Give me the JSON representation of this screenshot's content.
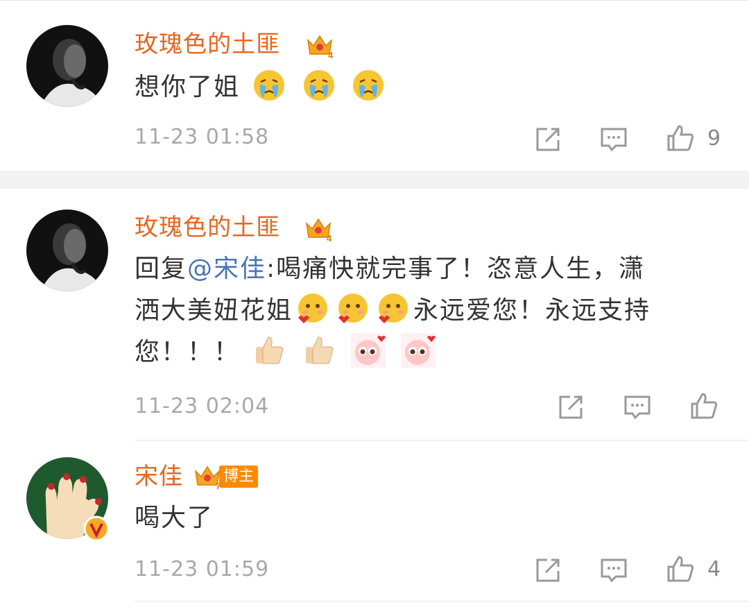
{
  "comments": [
    {
      "username": "玫瑰色的土匪",
      "level": "4",
      "text": "想你了姐",
      "emojis": [
        "crying-face",
        "crying-face",
        "crying-face"
      ],
      "timestamp": "11-23 01:58",
      "likes": "9"
    },
    {
      "username": "玫瑰色的土匪",
      "level": "4",
      "reply_prefix": "回复",
      "mention": "@宋佳",
      "line1_text": ":喝痛快就完事了！恣意人生，潇",
      "line2_text": "洒大美妞花姐",
      "line2_after": "永远爱您！永远支持",
      "line3_text": "您！！！",
      "timestamp": "11-23 02:04",
      "likes": ""
    },
    {
      "username": "宋佳",
      "level": "7",
      "role_badge": "博主",
      "text": "喝大了",
      "timestamp": "11-23 01:59",
      "likes": "4"
    }
  ],
  "icons": {
    "share": "share-icon",
    "comment": "comment-icon",
    "like": "thumbs-up-icon"
  },
  "colors": {
    "username": "#e8661e",
    "mention": "#4a76b8",
    "timestamp": "#a8a8a8",
    "text": "#333333"
  }
}
